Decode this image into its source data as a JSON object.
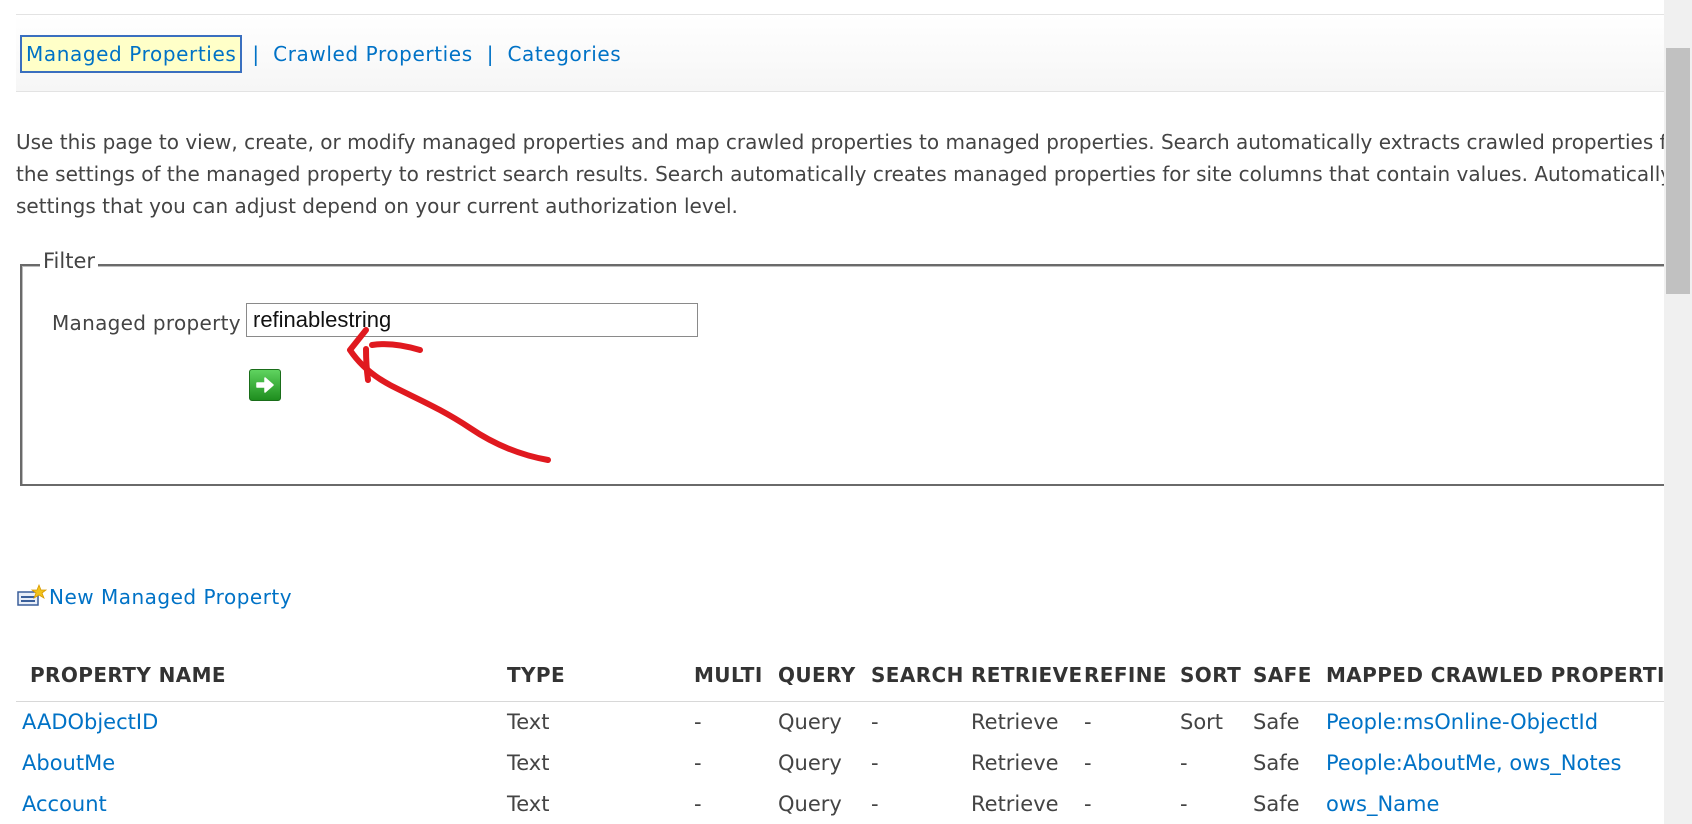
{
  "nav": {
    "tabs": [
      {
        "label": "Managed Properties",
        "active": true
      },
      {
        "label": "Crawled Properties",
        "active": false
      },
      {
        "label": "Categories",
        "active": false
      }
    ],
    "separator": "|"
  },
  "description": {
    "lines": [
      "Use this page to view, create, or modify managed properties and map crawled properties to managed properties. Search automatically extracts crawled properties from",
      "the settings of the managed property to restrict search results. Search automatically creates managed properties for site columns that contain values. Automatically cr",
      "settings that you can adjust depend on your current authorization level."
    ]
  },
  "filter": {
    "legend": "Filter",
    "label": "Managed property",
    "value": "refinablestring"
  },
  "new_property": {
    "label": "New Managed Property"
  },
  "table": {
    "headers": {
      "name": "PROPERTY NAME",
      "type": "TYPE",
      "multi": "MULTI",
      "query": "QUERY",
      "search": "SEARCH",
      "retrieve": "RETRIEVE",
      "refine": "REFINE",
      "sort": "SORT",
      "safe": "SAFE",
      "mapped": "MAPPED CRAWLED PROPERTIES"
    },
    "rows": [
      {
        "name": "AADObjectID",
        "type": "Text",
        "multi": "-",
        "query": "Query",
        "search": "-",
        "retrieve": "Retrieve",
        "refine": "-",
        "sort": "Sort",
        "safe": "Safe",
        "mapped": "People:msOnline-ObjectId"
      },
      {
        "name": "AboutMe",
        "type": "Text",
        "multi": "-",
        "query": "Query",
        "search": "-",
        "retrieve": "Retrieve",
        "refine": "-",
        "sort": "-",
        "safe": "Safe",
        "mapped": "People:AboutMe, ows_Notes"
      },
      {
        "name": "Account",
        "type": "Text",
        "multi": "-",
        "query": "Query",
        "search": "-",
        "retrieve": "Retrieve",
        "refine": "-",
        "sort": "-",
        "safe": "Safe",
        "mapped": "ows_Name"
      }
    ]
  },
  "colors": {
    "link": "#0072c6",
    "active_tab_bg": "#ffffc8",
    "annotation": "#e0191f",
    "go_button": "#2ea82e"
  },
  "icons": {
    "go": "arrow-right-icon",
    "new": "new-property-icon"
  }
}
